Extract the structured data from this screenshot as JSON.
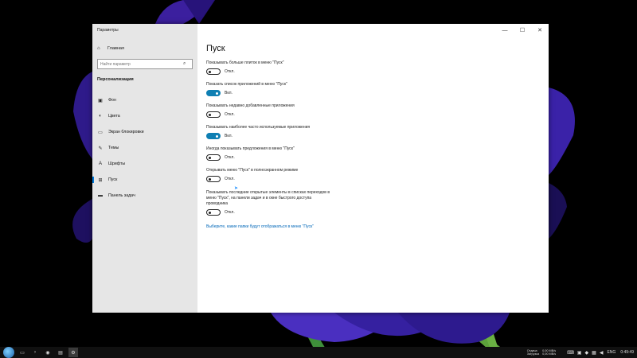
{
  "window": {
    "title": "Параметры",
    "controls": [
      "—",
      "☐",
      "✕"
    ]
  },
  "sidebar": {
    "home": {
      "icon": "home-icon",
      "label": "Главная"
    },
    "search": {
      "placeholder": "Найти параметр",
      "icon": "search-icon"
    },
    "section_title": "Персонализация",
    "items": [
      {
        "icon": "picture-icon",
        "label": "Фон",
        "active": false
      },
      {
        "icon": "palette-icon",
        "label": "Цвета",
        "active": false
      },
      {
        "icon": "monitor-icon",
        "label": "Экран блокировки",
        "active": false
      },
      {
        "icon": "brush-icon",
        "label": "Темы",
        "active": false
      },
      {
        "icon": "font-icon",
        "label": "Шрифты",
        "active": false
      },
      {
        "icon": "start-icon",
        "label": "Пуск",
        "active": true
      },
      {
        "icon": "taskbar-icon",
        "label": "Панель задач",
        "active": false
      }
    ]
  },
  "main": {
    "title": "Пуск",
    "settings": [
      {
        "label": "Показывать больше плиток в меню \"Пуск\"",
        "on": false,
        "state": "Откл."
      },
      {
        "label": "Показать список приложений в меню \"Пуск\"",
        "on": true,
        "state": "Вкл."
      },
      {
        "label": "Показывать недавно добавленные приложения",
        "on": false,
        "state": "Откл."
      },
      {
        "label": "Показывать наиболее часто используемые приложения",
        "on": true,
        "state": "Вкл."
      },
      {
        "label": "Иногда показывать предложения в меню \"Пуск\"",
        "on": false,
        "state": "Откл."
      },
      {
        "label": "Открывать меню \"Пуск\" в полноэкранном режиме",
        "on": false,
        "state": "Откл."
      },
      {
        "label_lines": [
          "Показывать последние открытые элементы в списках переходов в",
          "меню \"Пуск\", на панели задач и в окне быстрого доступа",
          "проводника"
        ],
        "on": false,
        "state": "Откл."
      }
    ],
    "link": "Выберите, какие папки будут отображаться в меню \"Пуск\""
  },
  "taskbar": {
    "net": {
      "up_label": "Отдача",
      "down_label": "Загрузка",
      "up_value": "0,00 MB/s",
      "down_value": "0,00 MB/s"
    },
    "lang": "ENG",
    "time": "0:49:49"
  },
  "colors": {
    "accent": "#0f7fb3",
    "link": "#0067b8",
    "sidebar_bg": "#e6e6e6"
  }
}
